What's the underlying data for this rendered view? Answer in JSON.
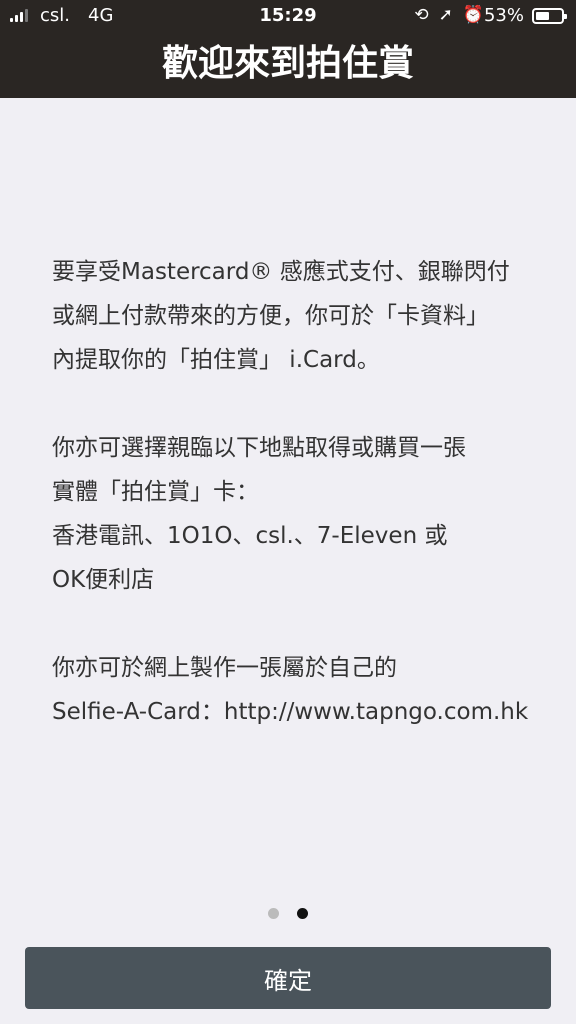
{
  "status_bar": {
    "carrier": "csl.",
    "network": "4G",
    "time": "15:29",
    "battery_percent": "53%",
    "battery_level": 0.53,
    "icons": [
      "rotation-lock-icon",
      "location-arrow-icon",
      "alarm-icon"
    ]
  },
  "header": {
    "title": "歡迎來到拍住賞"
  },
  "content": {
    "paragraph1": [
      "要享受Mastercard® 感應式支付、銀聯閃付",
      "或網上付款帶來的方便，你可於「卡資料」",
      "內提取你的「拍住賞」 i.Card。"
    ],
    "paragraph2": [
      "你亦可選擇親臨以下地點取得或購買一張",
      "實體「拍住賞」卡：",
      "香港電訊、1O1O、csl.、7-Eleven 或",
      "OK便利店"
    ],
    "paragraph3": [
      "你亦可於網上製作一張屬於自己的",
      "Selfie-A-Card：http://www.tapngo.com.hk"
    ]
  },
  "pager": {
    "total": 2,
    "current": 2
  },
  "confirm_button": {
    "label": "確定"
  },
  "colors": {
    "header_bg": "#2a2623",
    "page_bg": "#f0eff4",
    "button_bg": "#4a545b"
  }
}
